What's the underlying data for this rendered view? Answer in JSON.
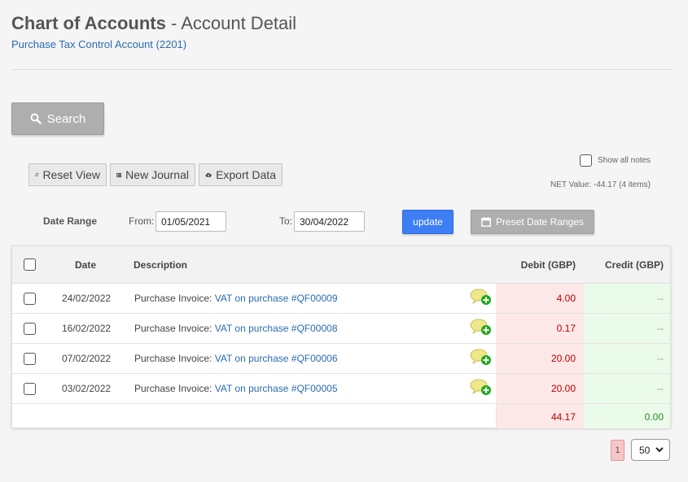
{
  "header": {
    "title_main": "Chart of Accounts",
    "title_sep": " - ",
    "title_sub": "Account Detail",
    "account_link": "Purchase Tax Control Account (2201)"
  },
  "search": {
    "label": "Search"
  },
  "toolbar": {
    "reset_label": "Reset View",
    "journal_label": "New Journal",
    "export_label": "Export Data"
  },
  "notes": {
    "show_all_label": "Show all notes",
    "net_value": "NET Value: -44.17 (4 items)"
  },
  "filters": {
    "date_range_label": "Date Range",
    "from_label": "From:",
    "from_value": "01/05/2021",
    "to_label": "To:",
    "to_value": "30/04/2022",
    "update_label": "update",
    "preset_label": "Preset Date Ranges"
  },
  "table": {
    "headers": {
      "date": "Date",
      "description": "Description",
      "debit": "Debit (GBP)",
      "credit": "Credit (GBP)"
    },
    "rows": [
      {
        "date": "24/02/2022",
        "type": "Purchase Invoice:",
        "link": "VAT on purchase #QF00009",
        "debit": "4.00",
        "credit": "--"
      },
      {
        "date": "16/02/2022",
        "type": "Purchase Invoice:",
        "link": "VAT on purchase #QF00008",
        "debit": "0.17",
        "credit": "--"
      },
      {
        "date": "07/02/2022",
        "type": "Purchase Invoice:",
        "link": "VAT on purchase #QF00006",
        "debit": "20.00",
        "credit": "--"
      },
      {
        "date": "03/02/2022",
        "type": "Purchase Invoice:",
        "link": "VAT on purchase #QF00005",
        "debit": "20.00",
        "credit": "--"
      }
    ],
    "totals": {
      "debit": "44.17",
      "credit": "0.00"
    }
  },
  "pagination": {
    "current": "1",
    "page_size": "50"
  },
  "colors": {
    "accent": "#3d7ef5",
    "link": "#2a6bb0",
    "debit": "#b00000",
    "credit": "#2a8a2a"
  }
}
